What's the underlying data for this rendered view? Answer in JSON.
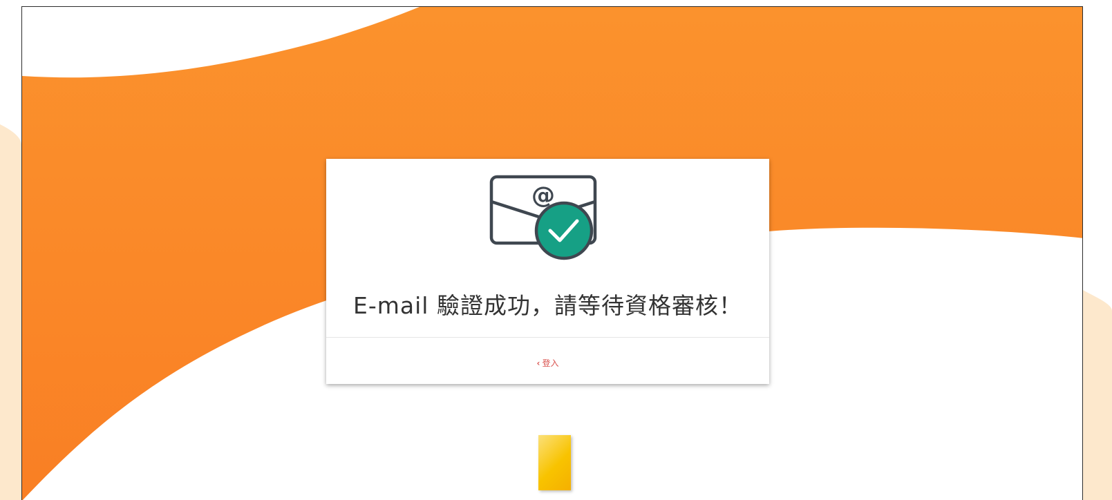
{
  "card": {
    "title": "E-mail 驗證成功，請等待資格審核！",
    "back_link_chevron": "‹",
    "back_link_label": "登入"
  },
  "icons": {
    "status_icon": "email-verified-icon",
    "back_icon": "chevron-left-icon"
  },
  "colors": {
    "brand_orange": "#f98e2a",
    "check_green": "#16a085",
    "link_red": "#d9534f",
    "side_cream": "#fde8cc",
    "block_yellow": "#f8c300"
  }
}
